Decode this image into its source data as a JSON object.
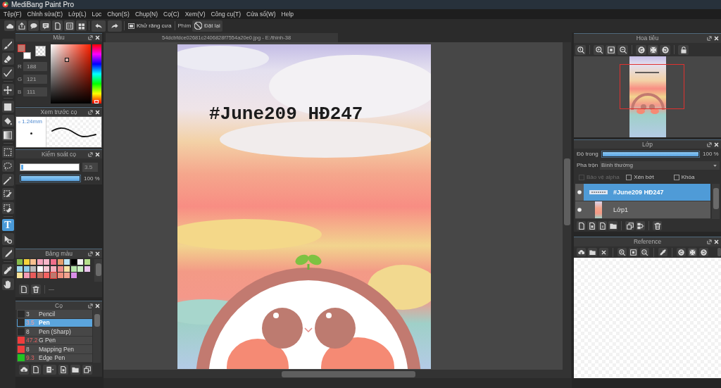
{
  "window": {
    "title": "MediBang Paint Pro"
  },
  "menu": [
    "Tệp(F)",
    "Chỉnh sửa(E)",
    "Lớp(L)",
    "Lọc",
    "Chọn(S)",
    "Chụp(N)",
    "Cọ(C)",
    "Xem(V)",
    "Công cụ(T)",
    "Cửa sổ(W)",
    "Help"
  ],
  "toolbar": {
    "antialias_label": "Khử răng cưa",
    "keys_label": "Phím",
    "reset_button": "Đặt lại"
  },
  "tool_groups": [
    [
      {
        "kind": "brush",
        "selected": false
      },
      {
        "kind": "eraser",
        "selected": false
      },
      {
        "kind": "dot",
        "selected": false
      }
    ],
    [
      {
        "kind": "move",
        "selected": false
      }
    ],
    [
      {
        "kind": "fill-rect",
        "selected": false
      },
      {
        "kind": "bucket",
        "selected": false
      },
      {
        "kind": "gradient",
        "selected": false
      }
    ],
    [
      {
        "kind": "select",
        "selected": false
      },
      {
        "kind": "lasso",
        "selected": false
      },
      {
        "kind": "wand",
        "selected": false
      },
      {
        "kind": "select-pen",
        "selected": false
      },
      {
        "kind": "select-eraser",
        "selected": false
      }
    ],
    [
      {
        "kind": "text",
        "label": "T",
        "selected": true
      },
      {
        "kind": "operation",
        "selected": false
      },
      {
        "kind": "blade",
        "selected": false
      }
    ],
    [
      {
        "kind": "dropper",
        "selected": false
      },
      {
        "kind": "hand",
        "selected": false
      }
    ]
  ],
  "color_panel": {
    "title": "Màu",
    "channels": [
      {
        "label": "R",
        "value": "188"
      },
      {
        "label": "G",
        "value": "121"
      },
      {
        "label": "B",
        "value": "111"
      }
    ],
    "hue_slider": {
      "level": 0.02
    }
  },
  "brush_preview": {
    "title": "Xem trước cọ",
    "size": "1.24mm"
  },
  "brush_control": {
    "title": "Kiểm soát cọ",
    "sliders": [
      {
        "kind": "size",
        "level": 0.04,
        "reading": "3.5"
      },
      {
        "kind": "opacity",
        "level": 1,
        "reading": "100 %"
      }
    ]
  },
  "palette": {
    "title": "Bảng màu",
    "swatches": [
      {
        "color": "#86bb4a",
        "selected": false
      },
      {
        "color": "#f6d23a",
        "selected": false
      },
      {
        "color": "#f7c08f",
        "selected": false
      },
      {
        "color": "#f5a4bb",
        "selected": false
      },
      {
        "color": "#f8b6c9",
        "selected": false
      },
      {
        "color": "#ef6f8b",
        "selected": false
      },
      {
        "color": "#e49d6c",
        "selected": false
      },
      {
        "color": "#bbe4f6",
        "selected": false
      },
      {
        "color": "#000000",
        "selected": false
      },
      {
        "color": "#f4f0f6",
        "selected": false
      },
      {
        "color": "#b6e08c",
        "selected": false
      },
      {
        "color": "#9fd8ee",
        "selected": false
      },
      {
        "color": "#8ecbe9",
        "selected": false
      },
      {
        "color": "#b9b9b9",
        "selected": false
      },
      {
        "color": "#ffffff",
        "selected": false
      },
      {
        "color": "#f8c7d3",
        "selected": false
      },
      {
        "color": "#f3afbd",
        "selected": false
      },
      {
        "color": "#ef8c8b",
        "selected": false
      },
      {
        "color": "#f8e3a6",
        "selected": false
      },
      {
        "color": "#b5e4a9",
        "selected": false
      },
      {
        "color": "#c9edc1",
        "selected": false
      },
      {
        "color": "#eac3ed",
        "selected": false
      },
      {
        "color": "#f8e49b",
        "selected": false
      },
      {
        "color": "#f39bb4",
        "selected": false
      },
      {
        "color": "#e85b5a",
        "selected": false
      },
      {
        "color": "#c0705f",
        "selected": false
      },
      {
        "color": "#f36262",
        "selected": false
      },
      {
        "color": "#bc796f",
        "selected": true
      },
      {
        "color": "#f0907d",
        "selected": false
      },
      {
        "color": "#f3a28f",
        "selected": false
      },
      {
        "color": "#d98de8",
        "selected": false
      }
    ],
    "note": "—"
  },
  "brushes": {
    "title": "Cọ",
    "items": [
      {
        "size": "3",
        "name": "Pencil",
        "color": "#2a2a2a",
        "selected": false,
        "size_marked": false
      },
      {
        "size": "3.5",
        "name": "Pen",
        "color": "#2a2a2a",
        "selected": true,
        "size_marked": true
      },
      {
        "size": "8",
        "name": "Pen (Sharp)",
        "color": "#2a2a2a",
        "selected": false,
        "size_marked": false
      },
      {
        "size": "47.2",
        "name": "G Pen",
        "color": "#f03c3c",
        "selected": false,
        "size_marked": true
      },
      {
        "size": "8",
        "name": "Mapping Pen",
        "color": "#f03c3c",
        "selected": false,
        "size_marked": false
      },
      {
        "size": "9.3",
        "name": "Edge Pen",
        "color": "#22c322",
        "selected": false,
        "size_marked": true
      }
    ]
  },
  "canvas": {
    "tab": "54dcbfdce02681c2406828f7554a20e0.jpg - E:/thinh-38",
    "text_layer": "#June209 HĐ247"
  },
  "navigator": {
    "title": "Hoa tiêu"
  },
  "layers": {
    "title": "Lớp",
    "opacity_label": "Độ trong",
    "opacity": {
      "level": 1,
      "reading": "100 %"
    },
    "blend_label": "Pha trộn",
    "blend_mode": "Bình thường",
    "options": [
      {
        "label": "Bảo vệ alpha",
        "checked": false,
        "disabled": true
      },
      {
        "label": "Xén bớt",
        "checked": false,
        "disabled": false
      },
      {
        "label": "Khóa",
        "checked": false,
        "disabled": false
      }
    ],
    "items": [
      {
        "kind": "text",
        "name": "#June209 HĐ247",
        "selected": true
      },
      {
        "kind": "image",
        "name": "Lớp1",
        "selected": false
      }
    ]
  },
  "reference": {
    "title": "Reference"
  }
}
